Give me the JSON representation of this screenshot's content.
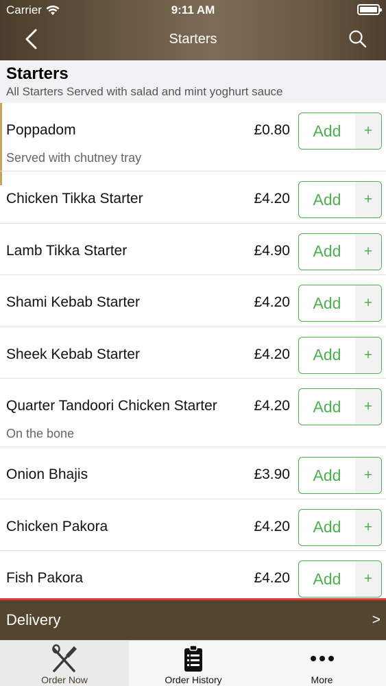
{
  "status_bar": {
    "carrier": "Carrier",
    "time": "9:11 AM"
  },
  "nav": {
    "title": "Starters"
  },
  "section": {
    "title": "Starters",
    "subtitle": "All Starters Served with salad and mint yoghurt sauce"
  },
  "add_label": "Add",
  "plus_label": "+",
  "items": [
    {
      "name": "Poppadom",
      "price": "£0.80",
      "desc": "Served with chutney tray"
    },
    {
      "name": "Chicken Tikka Starter",
      "price": "£4.20"
    },
    {
      "name": "Lamb Tikka Starter",
      "price": "£4.90"
    },
    {
      "name": "Shami Kebab Starter",
      "price": "£4.20"
    },
    {
      "name": "Sheek Kebab Starter",
      "price": "£4.20"
    },
    {
      "name": "Quarter Tandoori Chicken Starter",
      "price": "£4.20",
      "desc": "On the bone"
    },
    {
      "name": "Onion Bhajis",
      "price": "£3.90"
    },
    {
      "name": "Chicken Pakora",
      "price": "£4.20"
    },
    {
      "name": "Fish Pakora",
      "price": "£4.20"
    }
  ],
  "delivery": {
    "label": "Delivery",
    "arrow": ">"
  },
  "tabs": [
    {
      "label": "Order Now",
      "icon": "fork-knife-icon",
      "active": true
    },
    {
      "label": "Order History",
      "icon": "clipboard-list-icon",
      "active": false
    },
    {
      "label": "More",
      "icon": "more-dots-icon",
      "active": false
    }
  ],
  "colors": {
    "header_brown": "#6a5a45",
    "accent_green": "#4caf50",
    "delivery_bar": "#54452f",
    "delivery_border": "#e53935"
  }
}
